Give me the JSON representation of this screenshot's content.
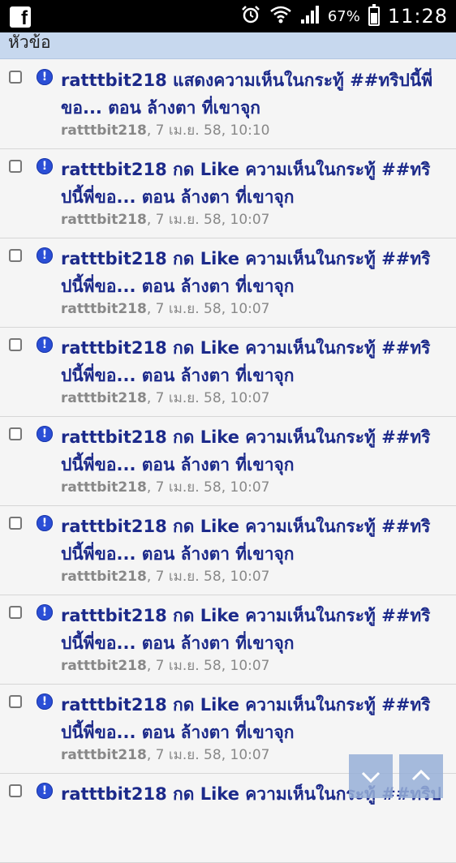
{
  "status_bar": {
    "app_icon": "facebook-icon",
    "battery_percent": "67%",
    "time": "11:28",
    "icons": [
      "alarm-icon",
      "wifi-icon",
      "signal-icon",
      "battery-icon"
    ]
  },
  "header": {
    "title": "หัวข้อ"
  },
  "items": [
    {
      "title": "ratttbit218 แสดงความเห็นในกระทู้ ##ทริปนี้พี่ขอ... ตอน ล้างตา ที่เขาจุก",
      "author": "ratttbit218",
      "time": ", 7 เม.ย. 58, 10:10"
    },
    {
      "title": "ratttbit218 กด Like ความเห็นในกระทู้ ##ทริปนี้พี่ขอ... ตอน ล้างตา ที่เขาจุก",
      "author": "ratttbit218",
      "time": ", 7 เม.ย. 58, 10:07"
    },
    {
      "title": "ratttbit218 กด Like ความเห็นในกระทู้ ##ทริปนี้พี่ขอ... ตอน ล้างตา ที่เขาจุก",
      "author": "ratttbit218",
      "time": ", 7 เม.ย. 58, 10:07"
    },
    {
      "title": "ratttbit218 กด Like ความเห็นในกระทู้ ##ทริปนี้พี่ขอ... ตอน ล้างตา ที่เขาจุก",
      "author": "ratttbit218",
      "time": ", 7 เม.ย. 58, 10:07"
    },
    {
      "title": "ratttbit218 กด Like ความเห็นในกระทู้ ##ทริปนี้พี่ขอ... ตอน ล้างตา ที่เขาจุก",
      "author": "ratttbit218",
      "time": ", 7 เม.ย. 58, 10:07"
    },
    {
      "title": "ratttbit218 กด Like ความเห็นในกระทู้ ##ทริปนี้พี่ขอ... ตอน ล้างตา ที่เขาจุก",
      "author": "ratttbit218",
      "time": ", 7 เม.ย. 58, 10:07"
    },
    {
      "title": "ratttbit218 กด Like ความเห็นในกระทู้ ##ทริปนี้พี่ขอ... ตอน ล้างตา ที่เขาจุก",
      "author": "ratttbit218",
      "time": ", 7 เม.ย. 58, 10:07"
    },
    {
      "title": "ratttbit218 กด Like ความเห็นในกระทู้ ##ทริปนี้พี่ขอ... ตอน ล้างตา ที่เขาจุก",
      "author": "ratttbit218",
      "time": ", 7 เม.ย. 58, 10:07"
    },
    {
      "title": "ratttbit218 กด Like ความเห็นในกระทู้ ##ทริป",
      "author": "",
      "time": ""
    }
  ],
  "scroll_controls": {
    "down_icon": "chevron-down-icon",
    "up_icon": "chevron-up-icon"
  },
  "colors": {
    "header_bg": "#c7d8ee",
    "title_text": "#1c2a8a",
    "alert_icon": "#2b4fd6",
    "meta_text": "#888888"
  }
}
